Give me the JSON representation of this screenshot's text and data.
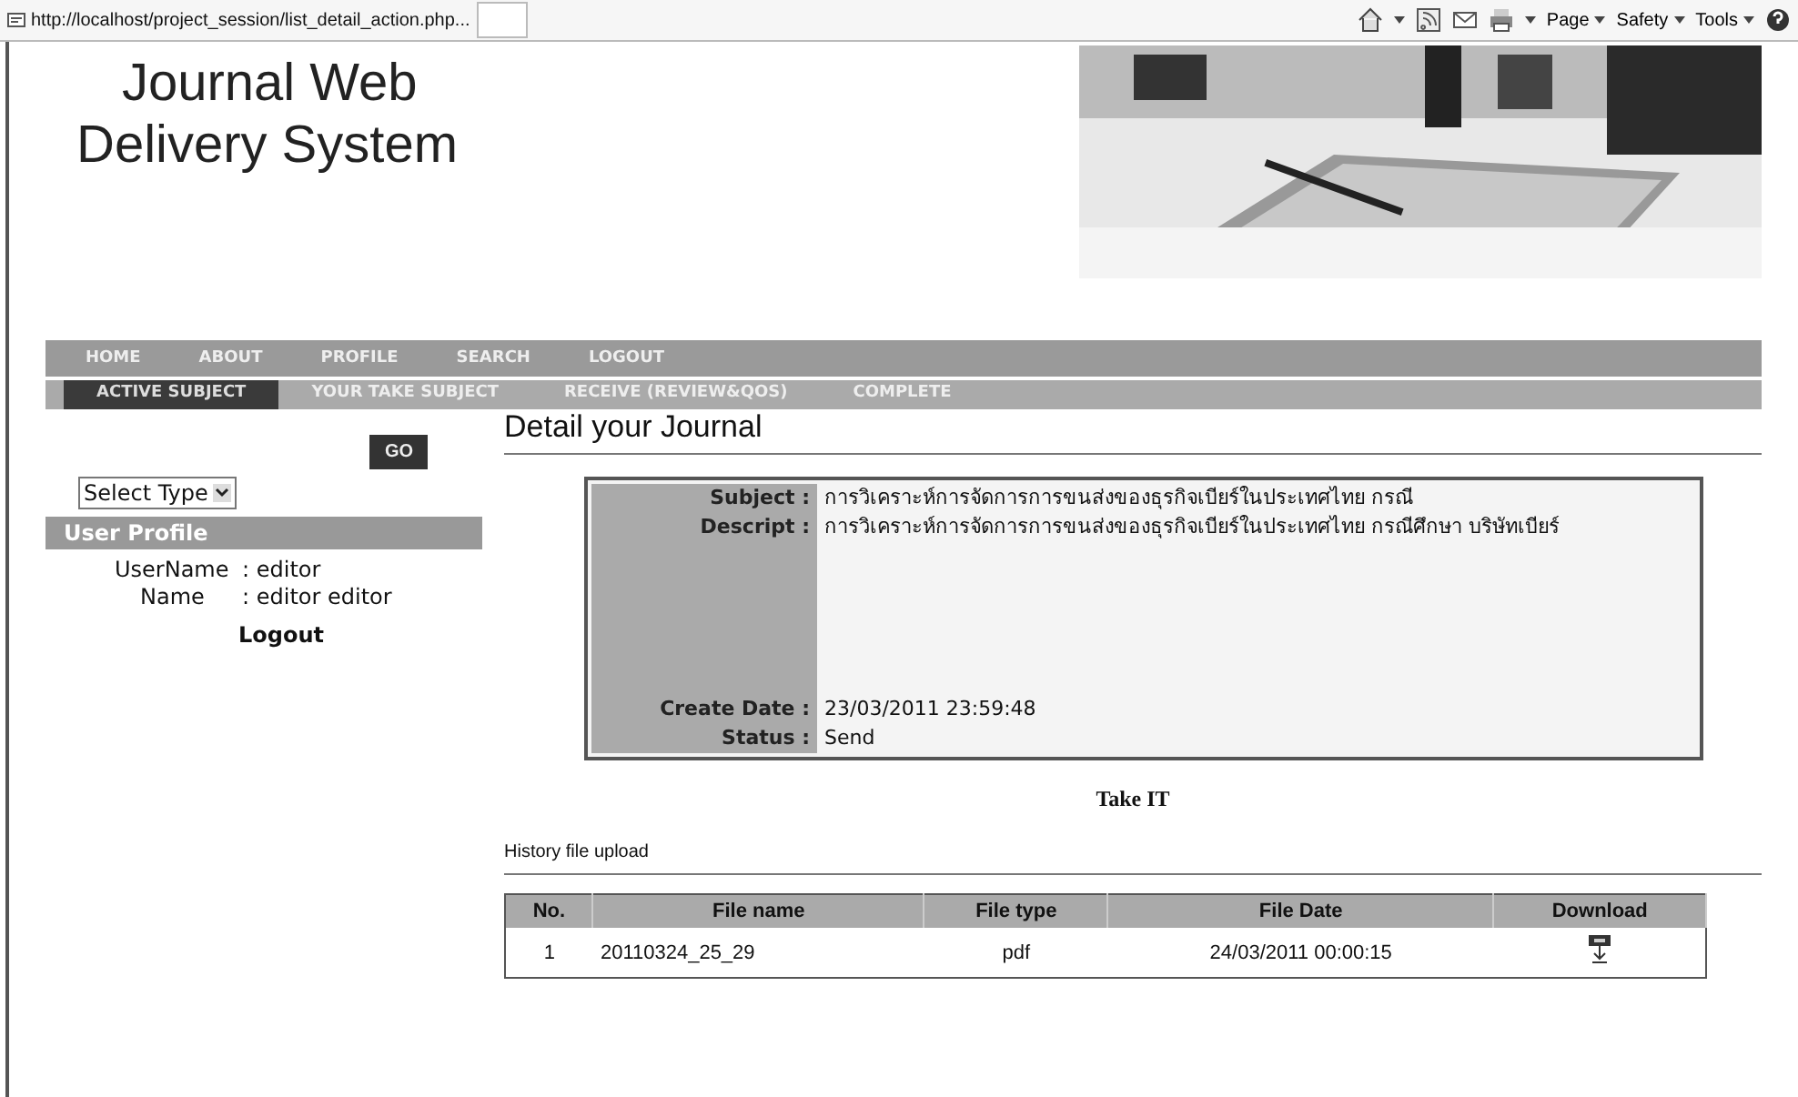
{
  "browser": {
    "address": "http://localhost/project_session/list_detail_action.php...",
    "menus": [
      "Page",
      "Safety",
      "Tools"
    ]
  },
  "header": {
    "title_lines": [
      "Journal Web",
      "Delivery System"
    ],
    "banner": {
      "kind": "picture"
    }
  },
  "main_nav": [
    "HOME",
    "ABOUT",
    "PROFILE",
    "SEARCH",
    "LOGOUT"
  ],
  "sub_nav": [
    {
      "label": "ACTIVE SUBJECT",
      "selected": true
    },
    {
      "label": "YOUR TAKE SUBJECT",
      "selected": false
    },
    {
      "label": "RECEIVE (REVIEW&QOS)",
      "selected": false
    },
    {
      "label": "COMPLETE",
      "selected": false
    }
  ],
  "sidebar": {
    "go_button": "GO",
    "type_select": "Select Type",
    "profile_title": "User Profile",
    "fields": [
      {
        "label": "UserName",
        "value": ": editor"
      },
      {
        "label": "Name",
        "value": ": editor editor"
      }
    ],
    "logout": "Logout"
  },
  "detail": {
    "title": "Detail your Journal",
    "rows": [
      {
        "label": "Subject :",
        "value": "การวิเคราะห์การจัดการการขนส่งของธุรกิจเบียร์ในประเทศไทย กรณี",
        "kind": "short"
      },
      {
        "label": "Descript :",
        "value": "การวิเคราะห์การจัดการการขนส่งของธุรกิจเบียร์ในประเทศไทย กรณีศึกษา บริษัทเบียร์",
        "kind": "tall"
      },
      {
        "label": "Create Date :",
        "value": "23/03/2011 23:59:48",
        "kind": "short"
      },
      {
        "label": "Status :",
        "value": "Send",
        "kind": "short"
      }
    ],
    "take_link": "Take IT"
  },
  "history": {
    "title": "History file upload",
    "columns": [
      "No.",
      "File name",
      "File type",
      "File Date",
      "Download"
    ],
    "rows": [
      {
        "no": "1",
        "file_name": "20110324_25_29",
        "file_type": "pdf",
        "file_date": "24/03/2011 00:00:15"
      }
    ]
  }
}
